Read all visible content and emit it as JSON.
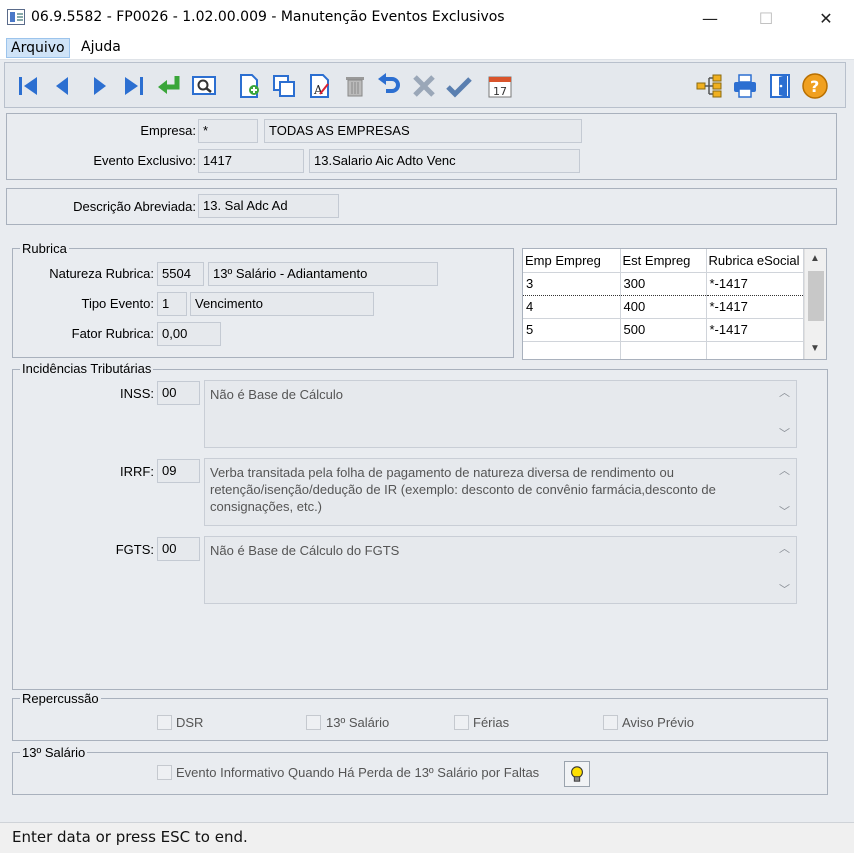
{
  "window": {
    "title": "06.9.5582 - FP0026 - 1.02.00.009 - Manutenção Eventos Exclusivos",
    "minimize": "—",
    "maximize": "☐",
    "close": "✕"
  },
  "menu": {
    "items": [
      "Arquivo",
      "Ajuda"
    ]
  },
  "toolbar": {
    "buttons": [
      "first-record",
      "previous-record",
      "next-record",
      "last-record",
      "confirm-enter",
      "view-search",
      "new-document",
      "copy-record",
      "edit-record",
      "delete-record",
      "undo",
      "cancel",
      "save-check",
      "calendar"
    ],
    "right_buttons": [
      "tree-structure",
      "print",
      "exit-door",
      "help"
    ],
    "calendar_day": "17",
    "help_glyph": "?"
  },
  "header": {
    "empresa_label": "Empresa:",
    "empresa_code": "*",
    "empresa_name": "TODAS AS EMPRESAS",
    "evento_label": "Evento Exclusivo:",
    "evento_code": "1417",
    "evento_name": "13.Salario Aic Adto Venc"
  },
  "descricao": {
    "label": "Descrição Abreviada:",
    "value": "13. Sal Adc Ad"
  },
  "rubrica": {
    "legend": "Rubrica",
    "natureza_label": "Natureza Rubrica:",
    "natureza_code": "5504",
    "natureza_desc": "13º Salário - Adiantamento",
    "tipo_label": "Tipo Evento:",
    "tipo_code": "1",
    "tipo_desc": "Vencimento",
    "fator_label": "Fator Rubrica:",
    "fator_value": "0,00"
  },
  "grid": {
    "columns": [
      "Emp Empreg",
      "Est Empreg",
      "Rubrica eSocial"
    ],
    "rows": [
      [
        "3",
        "300",
        "*-1417"
      ],
      [
        "4",
        "400",
        "*-1417"
      ],
      [
        "5",
        "500",
        "*-1417"
      ],
      [
        "",
        "",
        ""
      ]
    ]
  },
  "incidencias": {
    "legend": "Incidências Tributárias",
    "inss_label": "INSS:",
    "inss_code": "00",
    "inss_text": "Não é Base de Cálculo",
    "irrf_label": "IRRF:",
    "irrf_code": "09",
    "irrf_text": "Verba transitada pela folha de pagamento de natureza diversa de rendimento ou retenção/isenção/dedução de IR (exemplo: desconto de convênio farmácia,desconto de consignações, etc.)",
    "fgts_label": "FGTS:",
    "fgts_code": "00",
    "fgts_text": "Não é Base de Cálculo do FGTS"
  },
  "repercussao": {
    "legend": "Repercussão",
    "dsr": "DSR",
    "decimo": "13º Salário",
    "ferias": "Férias",
    "aviso": "Aviso Prévio"
  },
  "decimo_salario": {
    "legend": "13º Salário",
    "evento_informativo": "Evento Informativo Quando Há Perda de 13º Salário por Faltas"
  },
  "status": {
    "text": "Enter data or press ESC to end."
  },
  "colors": {
    "toolbar_blue": "#2c6fd1",
    "check_green": "#2f9e2f",
    "help_orange": "#f0a020"
  }
}
